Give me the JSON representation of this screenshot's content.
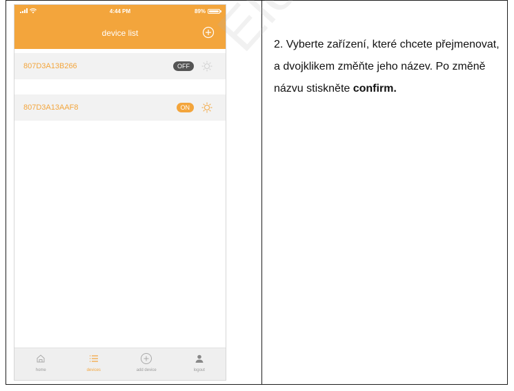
{
  "phone": {
    "status_bar": {
      "time": "4:44 PM",
      "battery": "89%"
    },
    "header": {
      "title": "device list",
      "add_icon": "plus-circle-icon"
    },
    "devices": [
      {
        "name": "807D3A13B266",
        "state": "OFF"
      },
      {
        "name": "807D3A13AAF8",
        "state": "ON"
      }
    ],
    "tabbar": [
      {
        "label": "home",
        "icon": "home-icon",
        "active": false
      },
      {
        "label": "devices",
        "icon": "list-icon",
        "active": true
      },
      {
        "label": "add device",
        "icon": "plus-circle-icon",
        "active": false
      },
      {
        "label": "logout",
        "icon": "user-icon",
        "active": false
      }
    ]
  },
  "instruction": {
    "text_before": "2. Vyberte zařízení, které chcete přejmenovat, a dvojklikem změňte jeho název. Po změně názvu stiskněte ",
    "bold": "confirm."
  },
  "watermark": "Elek",
  "colors": {
    "accent": "#f3a53c",
    "toggle_off": "#555555",
    "row_bg": "#f2f2f2"
  }
}
